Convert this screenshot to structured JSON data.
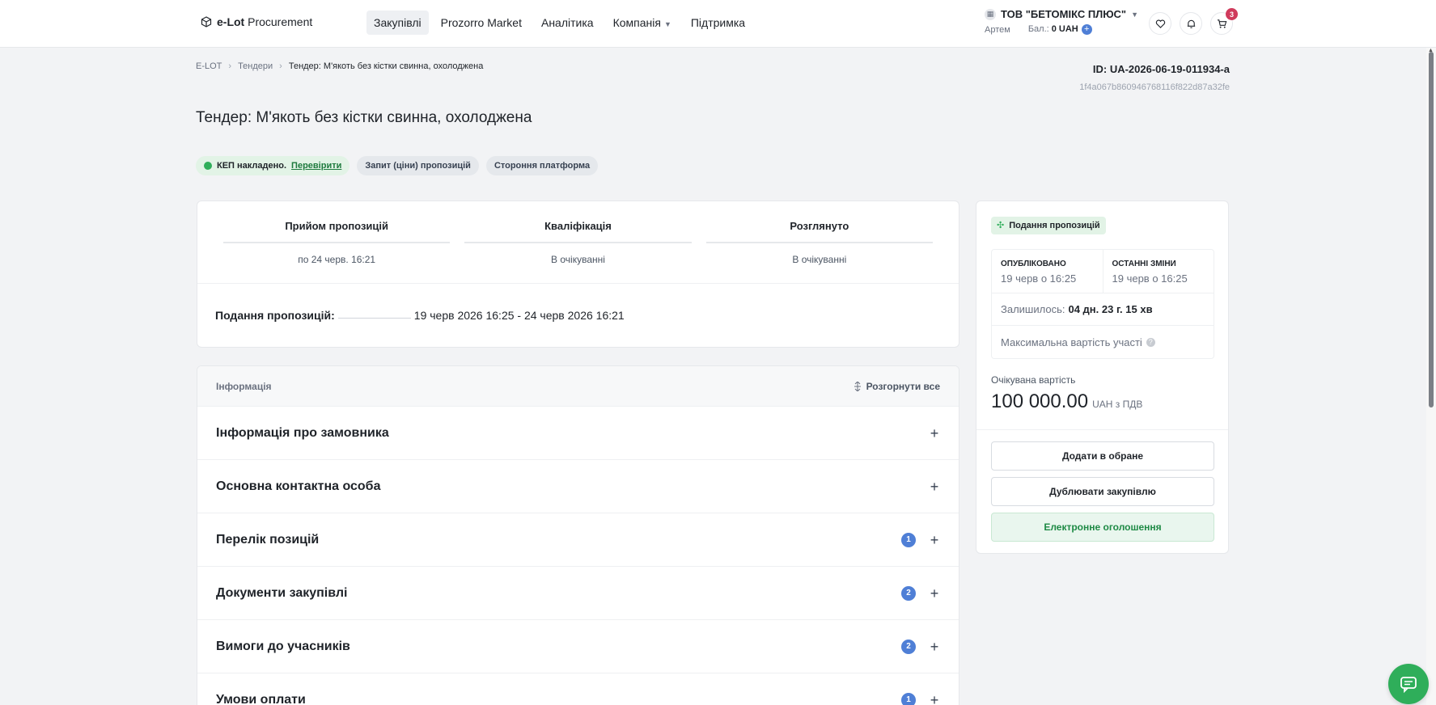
{
  "brand": {
    "name_bold": "e-Lot",
    "name_rest": "Procurement"
  },
  "nav": [
    {
      "label": "Закупівлі",
      "active": true
    },
    {
      "label": "Prozorro Market",
      "active": false
    },
    {
      "label": "Аналітика",
      "active": false
    },
    {
      "label": "Компанія",
      "active": false,
      "dropdown": true
    },
    {
      "label": "Підтримка",
      "active": false
    }
  ],
  "company": {
    "name": "ТОВ \"БЕТОМІКС ПЛЮС\"",
    "user": "Артем",
    "balance_label": "Бал.:",
    "balance_value": "0 UAH"
  },
  "cart": {
    "count": "3"
  },
  "breadcrumb": {
    "home": "E-LOT",
    "section": "Тендери",
    "current": "Тендер: М'якоть без кістки свинна, охолоджена"
  },
  "tender": {
    "id": "ID: UA-2026-06-19-011934-a",
    "hash": "1f4a067b860946768116f822d87a32fe",
    "title": "Тендер: М'якоть без кістки свинна, охолоджена"
  },
  "chips": {
    "kep": "КЕП накладено.",
    "verify": "Перевірити",
    "request": "Запит (ціни) пропозицій",
    "platform": "Стороння платформа"
  },
  "stages": [
    {
      "title": "Прийом пропозицій",
      "value": "по 24 черв. 16:21"
    },
    {
      "title": "Кваліфікація",
      "value": "В очікуванні"
    },
    {
      "title": "Розглянуто",
      "value": "В очікуванні"
    }
  ],
  "period": {
    "label": "Подання пропозицій:",
    "value": "19 черв 2026 16:25 - 24 черв 2026 16:21"
  },
  "info": {
    "header": "Інформація",
    "expand_all": "Розгорнути все",
    "sections": [
      {
        "title": "Інформація про замовника",
        "count": ""
      },
      {
        "title": "Основна контактна особа",
        "count": ""
      },
      {
        "title": "Перелік позицій",
        "count": "1"
      },
      {
        "title": "Документи закупівлі",
        "count": "2"
      },
      {
        "title": "Вимоги до учасників",
        "count": "2"
      },
      {
        "title": "Умови оплати",
        "count": "1"
      }
    ]
  },
  "side": {
    "status": "Подання пропозицій",
    "published_label": "ОПУБЛІКОВАНО",
    "published_value": "19 черв о 16:25",
    "changed_label": "ОСТАННІ ЗМІНИ",
    "changed_value": "19 черв о 16:25",
    "remaining_label": "Залишилось:",
    "remaining_value": "04 дн. 23 г. 15 хв",
    "max_cost_label": "Максимальна вартість участі",
    "expected_label": "Очікувана вартість",
    "expected_value": "100 000.00",
    "expected_currency": "UAH з ПДВ",
    "btn_favorite": "Додати в обране",
    "btn_duplicate": "Дублювати закупівлю",
    "btn_announcement": "Електронне оголошення"
  },
  "colors": {
    "accent_green": "#2fae5a",
    "badge_blue": "#4f7fd6",
    "cart_badge": "#d03b5c"
  }
}
